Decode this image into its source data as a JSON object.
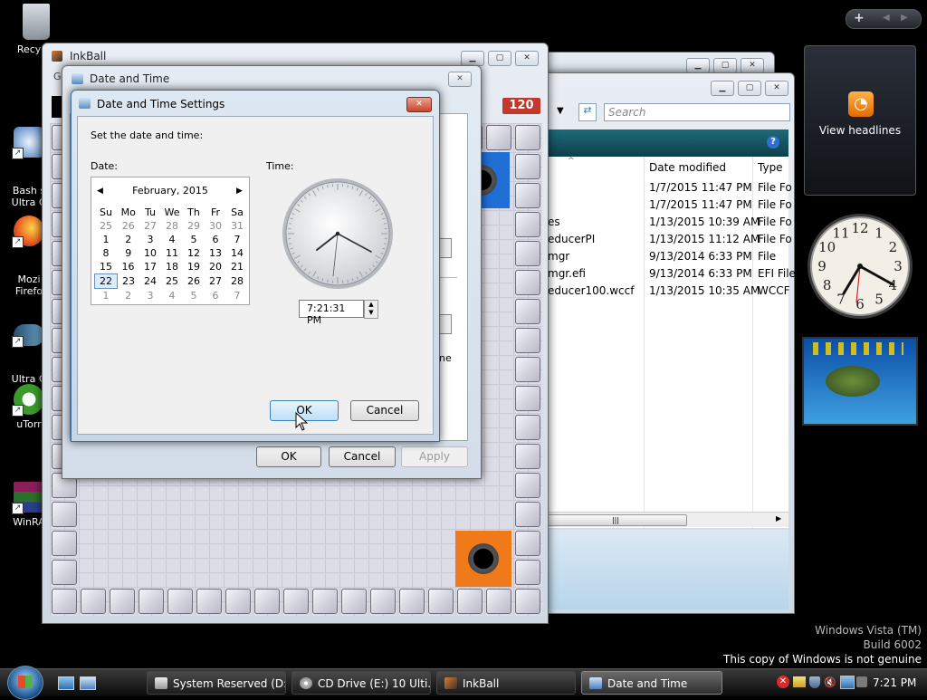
{
  "desktop": {
    "icons": [
      {
        "label": "Recycle"
      },
      {
        "label": "Bash s\nUltra G"
      },
      {
        "label": "Mozi\nFirefo"
      },
      {
        "label": "Ultra G\nFish"
      },
      {
        "label": "uTorr"
      },
      {
        "label": "WinRA"
      }
    ],
    "watermark": {
      "line1": "Windows Vista (TM)",
      "line2": "Build 6002",
      "line3": "This copy of Windows is not genuine"
    }
  },
  "sidebar": {
    "top_buttons": [
      "+",
      "◀",
      "▶"
    ],
    "feed_label": "View headlines"
  },
  "inkball": {
    "title": "InkBall",
    "menu_letter": "G",
    "score": "120"
  },
  "explorer": {
    "search_placeholder": "Search",
    "columns": {
      "date": "Date modified",
      "type": "Type"
    },
    "rows": [
      {
        "name": "",
        "date": "1/7/2015 11:47 PM",
        "type": "File Fo"
      },
      {
        "name": "",
        "date": "1/7/2015 11:47 PM",
        "type": "File Fo"
      },
      {
        "name": "es",
        "date": "1/13/2015 10:39 AM",
        "type": "File Fo"
      },
      {
        "name": "educerPI",
        "date": "1/13/2015 11:12 AM",
        "type": "File Fo"
      },
      {
        "name": "mgr",
        "date": "9/13/2014 6:33 PM",
        "type": "File"
      },
      {
        "name": "mgr.efi",
        "date": "9/13/2014 6:33 PM",
        "type": "EFI File"
      },
      {
        "name": "educer100.wccf",
        "date": "1/13/2015 10:35 AM",
        "type": "WCCF"
      }
    ]
  },
  "dt_outer": {
    "title": "Date and Time",
    "partial_text": "ne",
    "ok": "OK",
    "cancel": "Cancel",
    "apply": "Apply"
  },
  "dt_settings": {
    "title": "Date and Time Settings",
    "instruction": "Set the date and time:",
    "date_label": "Date:",
    "time_label": "Time:",
    "month": "February, 2015",
    "weekdays": [
      "Su",
      "Mo",
      "Tu",
      "We",
      "Th",
      "Fr",
      "Sa"
    ],
    "weeks": [
      [
        "25",
        "26",
        "27",
        "28",
        "29",
        "30",
        "31"
      ],
      [
        "1",
        "2",
        "3",
        "4",
        "5",
        "6",
        "7"
      ],
      [
        "8",
        "9",
        "10",
        "11",
        "12",
        "13",
        "14"
      ],
      [
        "15",
        "16",
        "17",
        "18",
        "19",
        "20",
        "21"
      ],
      [
        "22",
        "23",
        "24",
        "25",
        "26",
        "27",
        "28"
      ],
      [
        "1",
        "2",
        "3",
        "4",
        "5",
        "6",
        "7"
      ]
    ],
    "selected_day": "22",
    "time_value": "7:21:31 PM",
    "ok": "OK",
    "cancel": "Cancel"
  },
  "taskbar": {
    "buttons": [
      {
        "label": "System Reserved (D:)"
      },
      {
        "label": "CD Drive (E:) 10 Ulti..."
      },
      {
        "label": "InkBall"
      },
      {
        "label": "Date and Time"
      }
    ],
    "clock": "7:21 PM"
  },
  "colors": {
    "accent": "#2f7fc1",
    "score_bg": "#c0392b",
    "hole_orange": "#f07a1a",
    "hole_blue": "#1f6fd6"
  }
}
